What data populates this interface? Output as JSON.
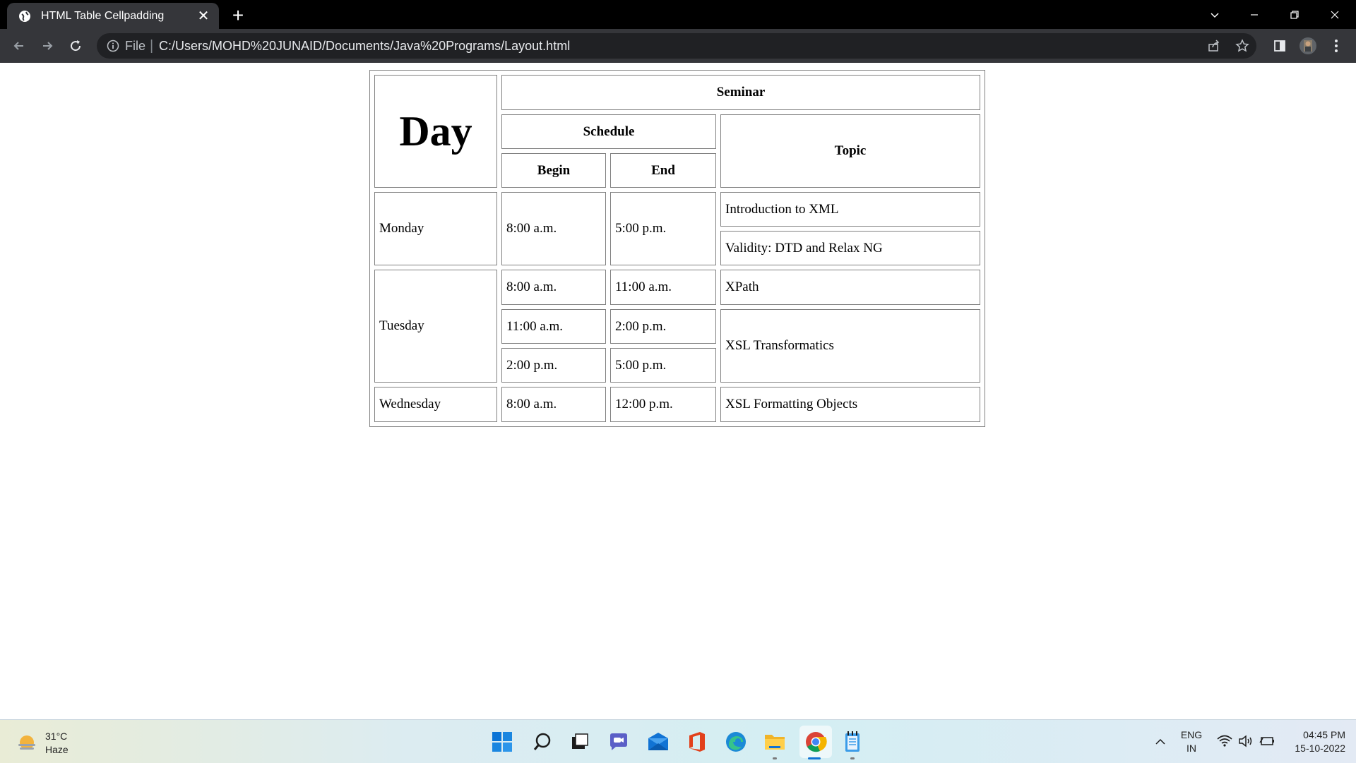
{
  "browser": {
    "tab_title": "HTML Table Cellpadding",
    "new_tab_symbol": "+",
    "close_symbol": "✕",
    "address_scheme": "File",
    "address_url": "C:/Users/MOHD%20JUNAID/Documents/Java%20Programs/Layout.html"
  },
  "table": {
    "day_header": "Day",
    "seminar_header": "Seminar",
    "schedule_header": "Schedule",
    "begin_header": "Begin",
    "end_header": "End",
    "topic_header": "Topic",
    "monday": {
      "day": "Monday",
      "begin": "8:00 a.m.",
      "end": "5:00 p.m.",
      "topic1": "Introduction to XML",
      "topic2": "Validity: DTD and Relax NG"
    },
    "tuesday": {
      "day": "Tuesday",
      "begin1": "8:00 a.m.",
      "end1": "11:00 a.m.",
      "topic1": "XPath",
      "begin2": "11:00 a.m.",
      "end2": "2:00 p.m.",
      "topic2": "XSL Transformatics",
      "begin3": "2:00 p.m.",
      "end3": "5:00 p.m."
    },
    "wednesday": {
      "day": "Wednesday",
      "begin": "8:00 a.m.",
      "end": "12:00 p.m.",
      "topic": "XSL Formatting Objects"
    }
  },
  "taskbar": {
    "weather_temp": "31°C",
    "weather_desc": "Haze",
    "lang_top": "ENG",
    "lang_bottom": "IN",
    "time": "04:45 PM",
    "date": "15-10-2022"
  }
}
